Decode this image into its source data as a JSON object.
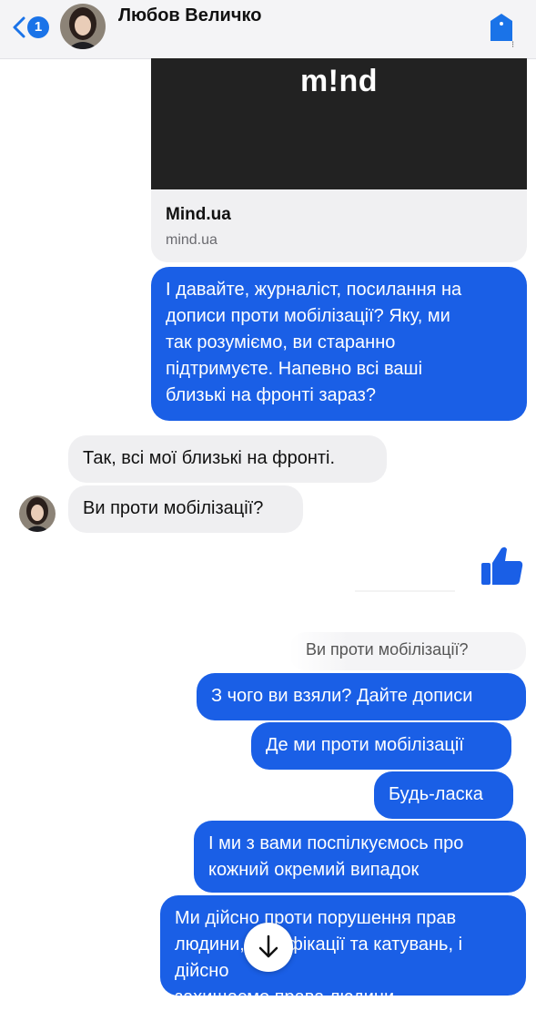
{
  "header": {
    "back_badge": "1",
    "contact_name": "Любов Величко"
  },
  "link_preview": {
    "logo_text": "m!nd",
    "title": "Mind.ua",
    "domain": "mind.ua"
  },
  "messages": [
    {
      "side": "outgoing",
      "text": "І давайте, журналіст, посилання на\nдописи проти мобілізації? Яку, ми\nтак розуміємо, ви старанно\nпідтримуєте. Напевно всі ваші\nблизькі на фронті зараз?"
    },
    {
      "side": "incoming",
      "text": "Так, всі мої близькі на фронті."
    },
    {
      "side": "incoming",
      "text": "Ви проти мобілізації?"
    },
    {
      "side": "outgoing",
      "type": "like",
      "icon": "thumbs-up-icon"
    },
    {
      "side": "outgoing",
      "type": "reply-quote",
      "text": "Ви проти мобілізації?"
    },
    {
      "side": "outgoing",
      "text": "З чого ви взяли? Дайте дописи"
    },
    {
      "side": "outgoing",
      "text": "Де ми проти мобілізації"
    },
    {
      "side": "outgoing",
      "text": "Будь-ласка"
    },
    {
      "side": "outgoing",
      "text": "І ми з вами поспілкуємось про\nкожний окремий випадок"
    },
    {
      "side": "outgoing",
      "text": "Ми дійсно проти порушення прав\nлюдини, бусифікації та катувань, і дійсно\nзахищаємо права людини."
    }
  ],
  "colors": {
    "accent": "#1a5fe6",
    "incoming_bubble": "#efeff1",
    "header_bg": "#f4f4f6"
  },
  "icons": {
    "back": "chevron-left-icon",
    "info": "info-icon",
    "like": "thumbs-up-icon",
    "scroll": "arrow-down-icon"
  }
}
